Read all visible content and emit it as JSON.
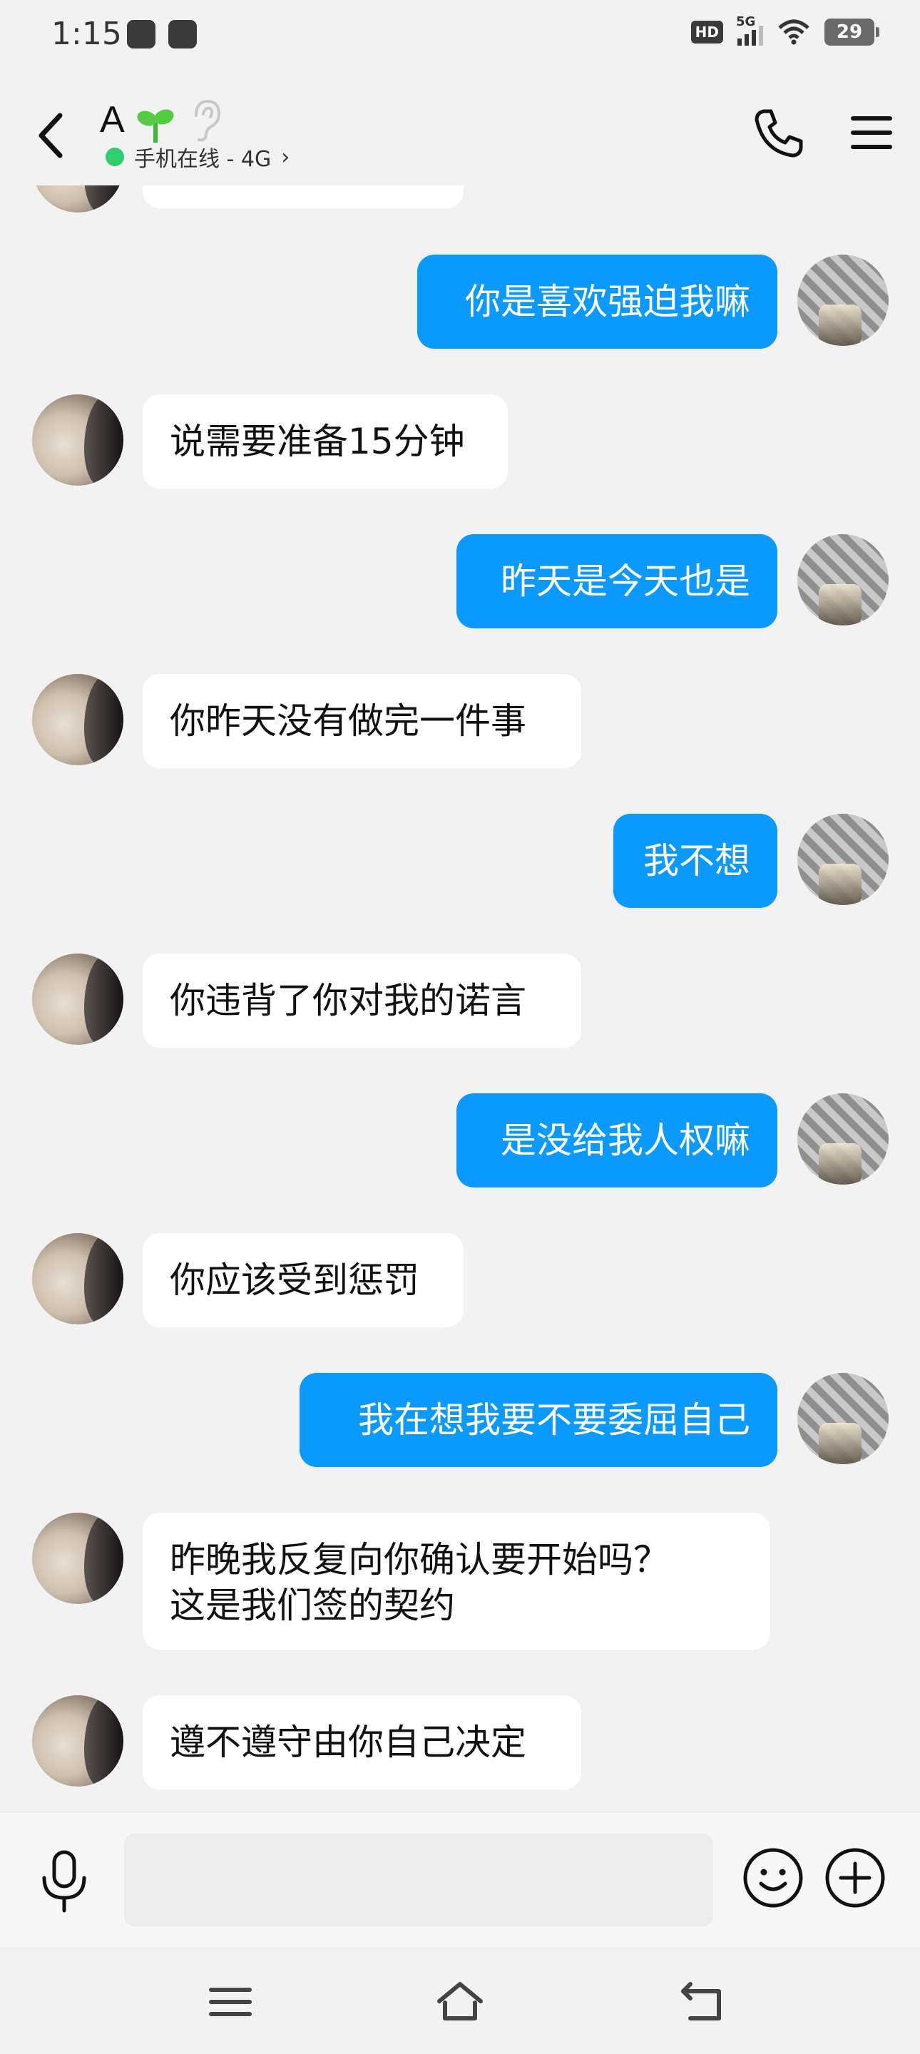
{
  "status_bar": {
    "time": "1:15",
    "hd": "HD",
    "network": "5G",
    "battery": "29"
  },
  "header": {
    "contact_name": "A",
    "online_status": "手机在线 - 4G",
    "chevron": "›"
  },
  "messages": [
    {
      "side": "out",
      "text": "你是喜欢强迫我嘛"
    },
    {
      "side": "in",
      "text": "说需要准备15分钟"
    },
    {
      "side": "out",
      "text": "昨天是今天也是"
    },
    {
      "side": "in",
      "text": "你昨天没有做完一件事"
    },
    {
      "side": "out",
      "text": "我不想"
    },
    {
      "side": "in",
      "text": "你违背了你对我的诺言"
    },
    {
      "side": "out",
      "text": "是没给我人权嘛"
    },
    {
      "side": "in",
      "text": "你应该受到惩罚"
    },
    {
      "side": "out",
      "text": "我在想我要不要委屈自己"
    },
    {
      "side": "in",
      "text": "昨晚我反复向你确认要开始吗？\n这是我们签的契约"
    },
    {
      "side": "in",
      "text": "遵不遵守由你自己决定"
    }
  ],
  "colors": {
    "outgoing_bubble": "#0a99ff",
    "incoming_bubble": "#ffffff",
    "background": "#f2f2f2",
    "online_dot": "#2ed06e"
  },
  "icons": {
    "back": "back-arrow-icon",
    "call": "phone-icon",
    "menu": "hamburger-menu-icon",
    "mic": "microphone-icon",
    "emoji": "smiley-icon",
    "plus": "plus-circle-icon",
    "nav_menu": "recent-apps-icon",
    "nav_home": "home-icon",
    "nav_back": "back-icon"
  }
}
